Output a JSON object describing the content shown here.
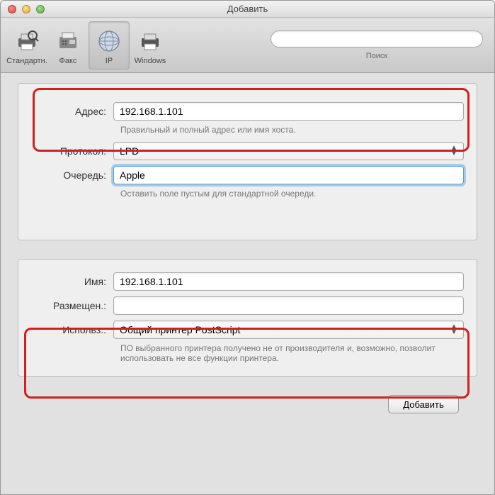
{
  "window": {
    "title": "Добавить"
  },
  "toolbar": {
    "items": [
      {
        "label": "Стандартн."
      },
      {
        "label": "Факс"
      },
      {
        "label": "IP"
      },
      {
        "label": "Windows"
      }
    ],
    "search_label": "Поиск",
    "search_value": ""
  },
  "form_top": {
    "address_label": "Адрес:",
    "address_value": "192.168.1.101",
    "address_hint": "Правильный и полный адрес или имя хоста.",
    "protocol_label": "Протокол:",
    "protocol_value": "LPD",
    "queue_label": "Очередь:",
    "queue_value": "Apple",
    "queue_hint": "Оставить поле пустым для стандартной очереди."
  },
  "form_bottom": {
    "name_label": "Имя:",
    "name_value": "192.168.1.101",
    "location_label": "Размещен.:",
    "location_value": "",
    "use_label": "Использ.:",
    "use_value": "Общий принтер PostScript",
    "use_hint": "ПО выбранного принтера получено не от производителя и, возможно, позволит использовать не все функции принтера."
  },
  "footer": {
    "add_button": "Добавить"
  }
}
